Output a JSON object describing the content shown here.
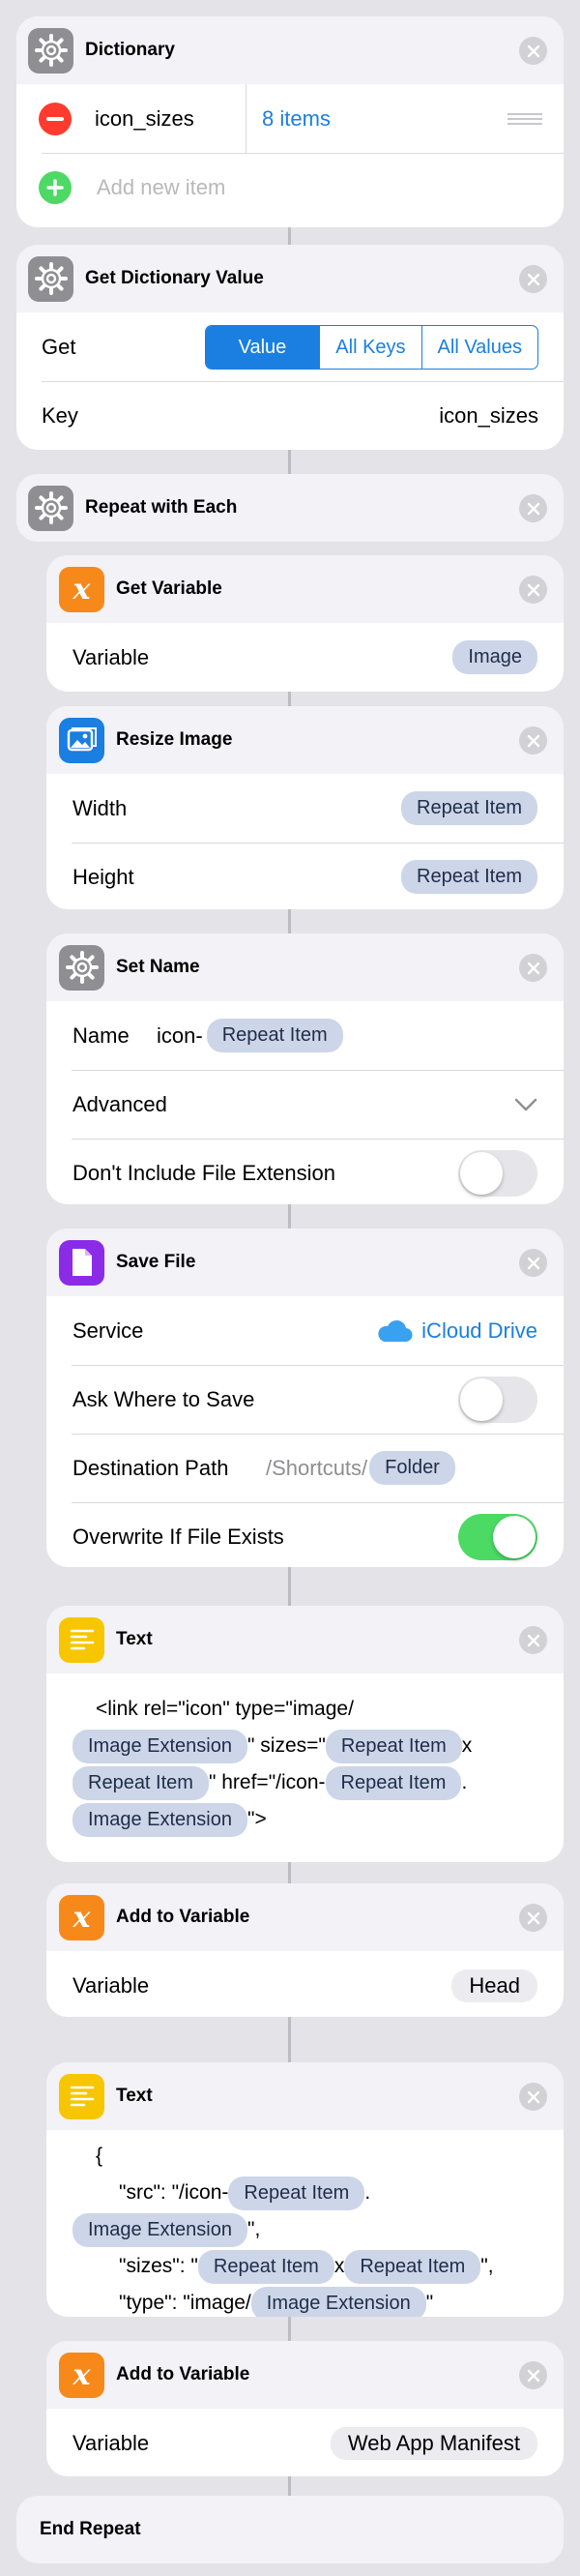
{
  "dictionary": {
    "title": "Dictionary",
    "key": "icon_sizes",
    "value": "8 items",
    "add_placeholder": "Add new item"
  },
  "get_dict": {
    "title": "Get Dictionary Value",
    "get_label": "Get",
    "options": [
      "Value",
      "All Keys",
      "All Values"
    ],
    "selected": "Value",
    "key_label": "Key",
    "key_value": "icon_sizes"
  },
  "repeat": {
    "title": "Repeat with Each",
    "end_title": "End Repeat"
  },
  "get_var": {
    "title": "Get Variable",
    "label": "Variable",
    "value": "Image"
  },
  "resize": {
    "title": "Resize Image",
    "width_label": "Width",
    "width_value": "Repeat Item",
    "height_label": "Height",
    "height_value": "Repeat Item"
  },
  "set_name": {
    "title": "Set Name",
    "name_label": "Name",
    "name_prefix": "icon-",
    "name_token": "Repeat Item",
    "advanced_label": "Advanced",
    "ext_label": "Don't Include File Extension",
    "ext_on": false
  },
  "save_file": {
    "title": "Save File",
    "service_label": "Service",
    "service_value": "iCloud Drive",
    "ask_label": "Ask Where to Save",
    "ask_on": false,
    "dest_label": "Destination Path",
    "dest_path": "/Shortcuts/",
    "dest_token": "Folder",
    "overwrite_label": "Overwrite If File Exists",
    "overwrite_on": true
  },
  "text1": {
    "title": "Text",
    "l1": "<link rel=\"icon\" type=\"image/",
    "l2_token1": "Image Extension",
    "l2_mid": "\" sizes=\"",
    "l2_token2": "Repeat Item",
    "l2_end": "x",
    "l3_token1": "Repeat Item",
    "l3_mid": "\" href=\"/icon-",
    "l3_token2": "Repeat Item",
    "l3_end": ".",
    "l4_token": "Image Extension",
    "l4_end": "\">"
  },
  "add_var1": {
    "title": "Add to Variable",
    "label": "Variable",
    "value": "Head"
  },
  "text2": {
    "title": "Text",
    "l1": "{",
    "l2_pre": "\"src\": \"/icon-",
    "l2_token": "Repeat Item",
    "l2_end": ".",
    "l3_token": "Image Extension",
    "l3_end": "\",",
    "l4_pre": "\"sizes\": \"",
    "l4_token1": "Repeat Item",
    "l4_mid": "x",
    "l4_token2": "Repeat Item",
    "l4_end": "\",",
    "l5_pre": "\"type\": \"image/",
    "l5_token": "Image Extension",
    "l5_end": "\""
  },
  "add_var2": {
    "title": "Add to Variable",
    "label": "Variable",
    "value": "Web App Manifest"
  },
  "colors": {
    "accent": "#1a7fe0",
    "toggle_on": "#4cd964",
    "remove": "#ff3b30",
    "add": "#4cd964",
    "orange": "#f7891a",
    "yellow": "#f7c600",
    "purple": "#8b2be8",
    "gear": "#8e8e93"
  }
}
